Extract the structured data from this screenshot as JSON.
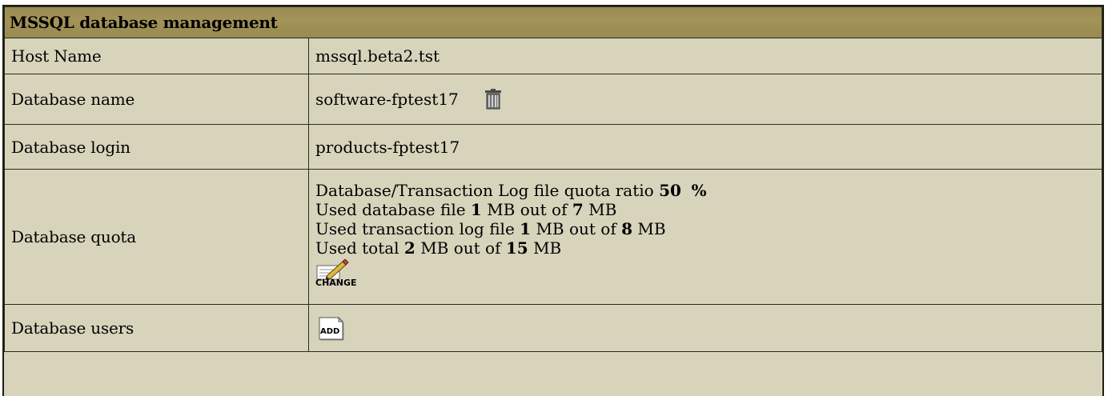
{
  "panel": {
    "title": "MSSQL database management"
  },
  "rows": {
    "host": {
      "label": "Host Name",
      "value": "mssql.beta2.tst"
    },
    "db_name": {
      "label": "Database name",
      "value": "software-fptest17",
      "delete_icon": "trash-icon"
    },
    "db_login": {
      "label": "Database login",
      "value": "products-fptest17"
    },
    "db_quota": {
      "label": "Database quota",
      "ratio_prefix": "Database/Transaction Log file quota ratio",
      "ratio_value": "50",
      "ratio_unit": "%",
      "db_file": {
        "prefix": "Used database file",
        "used": "1",
        "mid": "MB out of",
        "total": "7",
        "unit": "MB"
      },
      "log_file": {
        "prefix": "Used transaction log file",
        "used": "1",
        "mid": "MB out of",
        "total": "8",
        "unit": "MB"
      },
      "total": {
        "prefix": "Used total",
        "used": "2",
        "mid": "MB out of",
        "total": "15",
        "unit": "MB"
      },
      "change_label": "CHANGE",
      "change_icon": "pencil-edit-icon"
    },
    "db_users": {
      "label": "Database users",
      "add_label": "ADD",
      "add_icon": "add-document-icon"
    }
  },
  "colors": {
    "header_bg": "#a39358",
    "body_bg": "#d7d4bb",
    "border": "#2b2b20"
  }
}
